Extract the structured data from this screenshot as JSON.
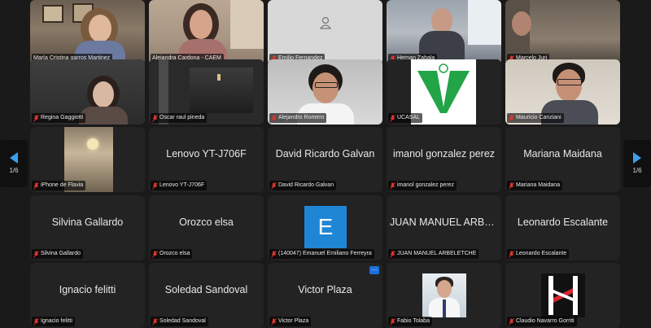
{
  "participants": [
    {
      "name": "María Cristina garros Martinez"
    },
    {
      "name": "Alejandra Cardona - CAEM"
    },
    {
      "name": "Emilio Fernandez"
    },
    {
      "name": "Hernan Zabala"
    },
    {
      "name": "Marcelo Juri"
    },
    {
      "name": "Regina Gaggiotti"
    },
    {
      "name": "Oscar raul pineda"
    },
    {
      "name": "Alejandro Romero"
    },
    {
      "name": "UCASAL",
      "logo_text": "UCASAL"
    },
    {
      "name": "Mauricio Canziani"
    },
    {
      "name": "iPhone de Flavia"
    },
    {
      "name": "Lenovo YT-J706F",
      "display": "Lenovo YT-J706F"
    },
    {
      "name": "David Ricardo Galvan",
      "display": "David Ricardo Galvan"
    },
    {
      "name": "imanol gonzalez perez",
      "display": "imanol gonzalez perez"
    },
    {
      "name": "Mariana Maidana",
      "display": "Mariana Maidana"
    },
    {
      "name": "Silvina Gallardo",
      "display": "Silvina Gallardo"
    },
    {
      "name": "Orozco elsa",
      "display": "Orozco elsa"
    },
    {
      "name": "(140047) Emanuel Emiliano Ferreyra",
      "avatar_letter": "E"
    },
    {
      "name": "JUAN MANUEL ARBELETCHE",
      "display": "JUAN MANUEL ARBELE..."
    },
    {
      "name": "Leonardo Escalante",
      "display": "Leonardo Escalante"
    },
    {
      "name": "Ignacio felitti",
      "display": "Ignacio felitti"
    },
    {
      "name": "Soledad Sandoval",
      "display": "Soledad Sandoval"
    },
    {
      "name": "Victor Plaza",
      "display": "Victor Plaza",
      "more": "..."
    },
    {
      "name": "Fabio Tolaba"
    },
    {
      "name": "Claudio Navarro Gorriti"
    }
  ],
  "pagination": {
    "left": "1/6",
    "right": "1/6"
  },
  "colors": {
    "active_border": "#3ec33e",
    "avatar_bg": "#1f86d6",
    "nav_arrow": "#3aa0e8",
    "muted_mic": "#e0342b"
  }
}
